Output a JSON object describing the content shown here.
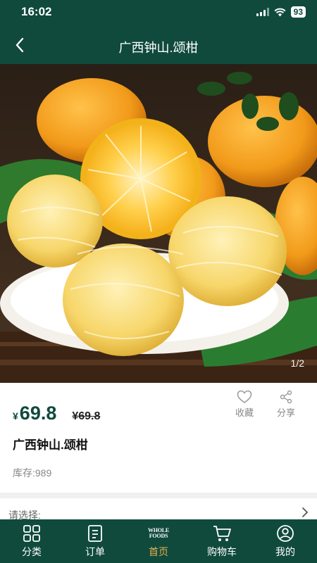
{
  "status": {
    "time": "16:02",
    "battery": "93"
  },
  "nav": {
    "title": "广西钟山.颂柑"
  },
  "gallery": {
    "indicator": "1/2"
  },
  "product": {
    "currency": "¥",
    "price": "69.8",
    "original_price": "¥69.8",
    "name": "广西钟山.颂柑",
    "stock": "库存:989",
    "favorite_label": "收藏",
    "share_label": "分享"
  },
  "options": {
    "label": "请选择:"
  },
  "tabbar": {
    "items": [
      {
        "label": "分类",
        "icon": "grid-icon"
      },
      {
        "label": "订单",
        "icon": "order-icon"
      },
      {
        "label": "首页",
        "icon": "whole-foods-logo",
        "logo_lines": [
          "WHOLE",
          "FOODS"
        ]
      },
      {
        "label": "购物车",
        "icon": "cart-icon"
      },
      {
        "label": "我的",
        "icon": "user-icon"
      }
    ],
    "active": "首页"
  },
  "colors": {
    "primary": "#0f4a3d",
    "active_tab": "#e9b04a"
  }
}
